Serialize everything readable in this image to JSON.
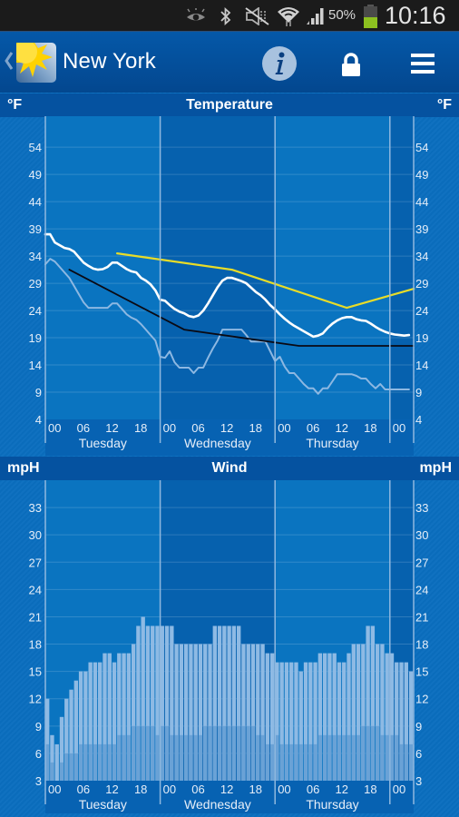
{
  "status_bar": {
    "icons": [
      "smart-stay-eye-icon",
      "bluetooth-icon",
      "mute-icon",
      "wifi-icon",
      "signal-icon",
      "battery-icon"
    ],
    "battery_text": "50%",
    "battery_level": 0.5,
    "time": "10:16"
  },
  "app_bar": {
    "back_icon": "chevron-left-icon",
    "logo_icon": "sun-logo-icon",
    "title": "New York",
    "info_icon": "info-icon",
    "lock_icon": "lock-icon",
    "menu_icon": "hamburger-menu-icon"
  },
  "colors": {
    "accent": "#0552a0",
    "temperature_line": "#ffffff",
    "feels_like_line": "#8db8e2",
    "yellow_line": "#e8dc28",
    "black_line": "#0a0a14",
    "gust_bar": "#8ebae4",
    "wind_bar": "#6aa2d6"
  },
  "chart_data": [
    {
      "type": "line",
      "title": "Temperature",
      "ylabel_left": "°F",
      "ylabel_right": "°F",
      "xlabel": "",
      "ylim": [
        4,
        59.7
      ],
      "xlim_hours": [
        0,
        77
      ],
      "grid": true,
      "y_ticks": [
        4,
        9,
        14,
        19,
        24,
        29,
        34,
        39,
        44,
        49,
        54
      ],
      "x_tick_labels": [
        {
          "hour": 0,
          "label": "00"
        },
        {
          "hour": 6,
          "label": "06"
        },
        {
          "hour": 12,
          "label": "12"
        },
        {
          "hour": 18,
          "label": "18"
        },
        {
          "hour": 24,
          "label": "00"
        },
        {
          "hour": 30,
          "label": "06"
        },
        {
          "hour": 36,
          "label": "12"
        },
        {
          "hour": 42,
          "label": "18"
        },
        {
          "hour": 48,
          "label": "00"
        },
        {
          "hour": 54,
          "label": "06"
        },
        {
          "hour": 60,
          "label": "12"
        },
        {
          "hour": 66,
          "label": "18"
        },
        {
          "hour": 72,
          "label": "00"
        }
      ],
      "days": [
        {
          "label": "Tuesday",
          "start_hour": 0
        },
        {
          "label": "Wednesday",
          "start_hour": 24
        },
        {
          "label": "Thursday",
          "start_hour": 48
        },
        {
          "label": "",
          "start_hour": 72
        }
      ],
      "series": [
        {
          "name": "temperature",
          "color": "#ffffff",
          "values": [
            38,
            38,
            36.5,
            36,
            35.5,
            35.3,
            34.8,
            33.8,
            32.8,
            32.2,
            31.7,
            31.5,
            31.6,
            32,
            32.8,
            32.8,
            32.2,
            31.6,
            31.2,
            31,
            30,
            29.5,
            28.8,
            27.7,
            26,
            25.8,
            25,
            24.3,
            23.8,
            23.5,
            23,
            22.8,
            23.1,
            24,
            25.3,
            26.8,
            28.3,
            29.5,
            30,
            30,
            29.7,
            29.4,
            29,
            28.2,
            27.4,
            26.8,
            26,
            25,
            24.2,
            23.3,
            22.5,
            21.8,
            21.2,
            20.7,
            20.2,
            19.7,
            19.2,
            19.4,
            19.8,
            20.8,
            21.6,
            22.2,
            22.6,
            22.8,
            22.8,
            22.4,
            22.2,
            22.1,
            21.6,
            21,
            20.5,
            20.1,
            19.8,
            19.6,
            19.5,
            19.4,
            19.5
          ]
        },
        {
          "name": "feels like",
          "color": "#8db8e2",
          "values": [
            32.5,
            33.5,
            33,
            32,
            31,
            30,
            28.5,
            27,
            25.5,
            24.5,
            24.5,
            24.5,
            24.5,
            24.5,
            25.3,
            25.3,
            24.3,
            23.3,
            22.7,
            22.3,
            21.5,
            20.5,
            19.5,
            18.5,
            15.5,
            15.3,
            16.5,
            14.5,
            13.5,
            13.5,
            13.5,
            12.5,
            13.5,
            13.5,
            15.3,
            17,
            18.5,
            20.5,
            20.5,
            20.5,
            20.5,
            20.5,
            19.5,
            18.3,
            18.3,
            18.3,
            18.3,
            16.5,
            14.7,
            15.5,
            13.7,
            12.5,
            12.5,
            11.5,
            10.5,
            9.7,
            9.7,
            8.7,
            9.7,
            9.7,
            11,
            12.3,
            12.3,
            12.3,
            12.3,
            12,
            11.5,
            11.5,
            10.5,
            9.7,
            10.5,
            9.5,
            9.5,
            9.5,
            9.5,
            9.5,
            9.5
          ]
        },
        {
          "name": "yellow line",
          "color": "#e8dc28",
          "points": [
            [
              15,
              34.5
            ],
            [
              39,
              31.5
            ],
            [
              63,
              24.5
            ],
            [
              77,
              28
            ]
          ]
        },
        {
          "name": "black line",
          "color": "#0a0a14",
          "points": [
            [
              5,
              31.5
            ],
            [
              29,
              20.5
            ],
            [
              53,
              17.5
            ],
            [
              77,
              17.5
            ]
          ]
        }
      ]
    },
    {
      "type": "bar",
      "title": "Wind",
      "ylabel_left": "mpH",
      "ylabel_right": "mpH",
      "xlabel": "",
      "ylim": [
        3,
        36
      ],
      "xlim_hours": [
        0,
        77
      ],
      "grid": true,
      "y_ticks": [
        3,
        6,
        9,
        12,
        15,
        18,
        21,
        24,
        27,
        30,
        33
      ],
      "x_tick_labels": [
        {
          "hour": 0,
          "label": "00"
        },
        {
          "hour": 6,
          "label": "06"
        },
        {
          "hour": 12,
          "label": "12"
        },
        {
          "hour": 18,
          "label": "18"
        },
        {
          "hour": 24,
          "label": "00"
        },
        {
          "hour": 30,
          "label": "06"
        },
        {
          "hour": 36,
          "label": "12"
        },
        {
          "hour": 42,
          "label": "18"
        },
        {
          "hour": 48,
          "label": "00"
        },
        {
          "hour": 54,
          "label": "06"
        },
        {
          "hour": 60,
          "label": "12"
        },
        {
          "hour": 66,
          "label": "18"
        },
        {
          "hour": 72,
          "label": "00"
        }
      ],
      "days": [
        {
          "label": "Tuesday",
          "start_hour": 0
        },
        {
          "label": "Wednesday",
          "start_hour": 24
        },
        {
          "label": "Thursday",
          "start_hour": 48
        },
        {
          "label": "",
          "start_hour": 72
        }
      ],
      "series": [
        {
          "name": "gusts",
          "color": "#8ebae4",
          "values": [
            12,
            8,
            7,
            10,
            12,
            13,
            14,
            15,
            15,
            16,
            16,
            16,
            17,
            17,
            16,
            17,
            17,
            17,
            18,
            20,
            21,
            20,
            20,
            20,
            20,
            20,
            20,
            18,
            18,
            18,
            18,
            18,
            18,
            18,
            18,
            20,
            20,
            20,
            20,
            20,
            20,
            18,
            18,
            18,
            18,
            18,
            17,
            17,
            16,
            16,
            16,
            16,
            16,
            15,
            16,
            16,
            16,
            17,
            17,
            17,
            17,
            16,
            16,
            17,
            18,
            18,
            18,
            20,
            20,
            18,
            18,
            17,
            17,
            16,
            16,
            16,
            15
          ]
        },
        {
          "name": "wind speed",
          "color": "#6aa2d6",
          "values": [
            7,
            5,
            3,
            5,
            6,
            6,
            6,
            7,
            7,
            7,
            7,
            7,
            7,
            7,
            7,
            8,
            8,
            8,
            9,
            9,
            9,
            9,
            9,
            8,
            9,
            9,
            8,
            8,
            8,
            8,
            8,
            8,
            8,
            9,
            9,
            9,
            9,
            9,
            9,
            9,
            9,
            9,
            9,
            9,
            8,
            8,
            7,
            7,
            8,
            7,
            7,
            7,
            7,
            7,
            7,
            7,
            7,
            8,
            8,
            8,
            8,
            8,
            8,
            8,
            8,
            8,
            9,
            9,
            9,
            9,
            8,
            8,
            8,
            8,
            7,
            7,
            7
          ]
        }
      ]
    }
  ]
}
